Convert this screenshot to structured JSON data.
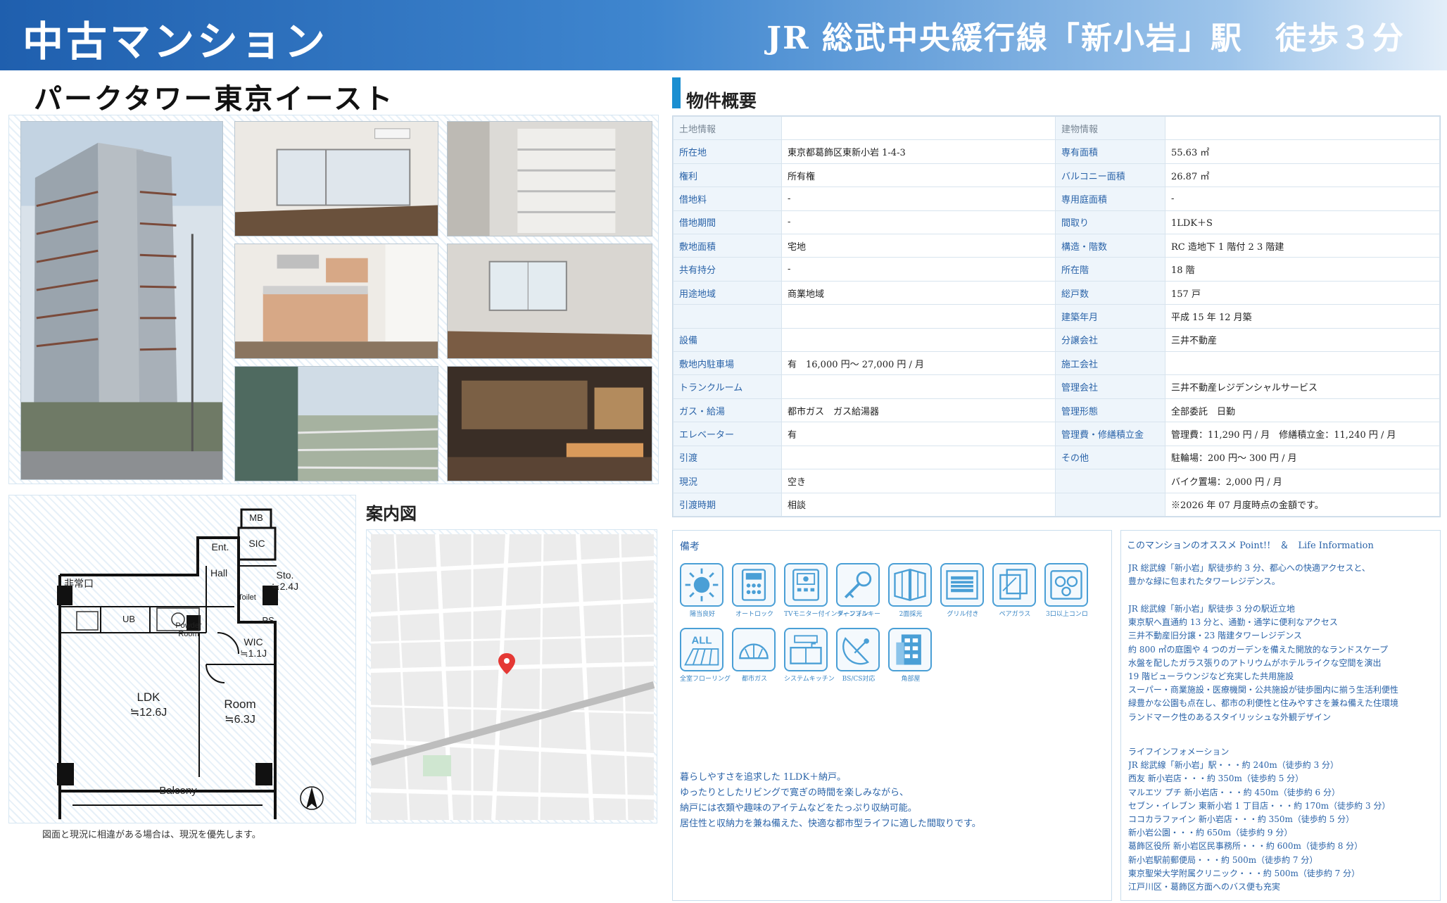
{
  "header": {
    "type_label": "中古マンション",
    "access": "JR 総武中央緩行線「新小岩」駅　徒歩３分"
  },
  "property_name": "パークタワー東京イースト",
  "floorplan": {
    "labels": {
      "mb": "MB",
      "sic": "SIC",
      "ent": "Ent.",
      "hall": "Hall",
      "sto": "Sto.",
      "sto_size": "≒2.4J",
      "emergency": "非常口",
      "toilet": "Toilet",
      "ps": "PS",
      "ub": "UB",
      "powder": "Powder",
      "powder2": "Room",
      "wic": "WIC",
      "wic_size": "≒1.1J",
      "ldk": "LDK",
      "ldk_size": "≒12.6J",
      "room": "Room",
      "room_size": "≒6.3J",
      "balcony": "Balcony"
    },
    "note": "図面と現況に相違がある場合は、現況を優先します。"
  },
  "map": {
    "title": "案内図"
  },
  "overview": {
    "title": "物件概要",
    "rows": [
      {
        "l1": "土地情報",
        "v1": "",
        "l2": "建物情報",
        "v2": ""
      },
      {
        "l1": "所在地",
        "v1": "東京都葛飾区東新小岩 1-4-3",
        "l2": "専有面積",
        "v2": "55.63 ㎡"
      },
      {
        "l1": "権利",
        "v1": "所有権",
        "l2": "バルコニー面積",
        "v2": "26.87 ㎡"
      },
      {
        "l1": "借地料",
        "v1": "-",
        "l2": "専用庭面積",
        "v2": "-"
      },
      {
        "l1": "借地期間",
        "v1": "-",
        "l2": "間取り",
        "v2": "1LDK＋S"
      },
      {
        "l1": "敷地面積",
        "v1": "宅地",
        "l2": "構造・階数",
        "v2": "RC 造地下 1 階付 2 3 階建"
      },
      {
        "l1": "共有持分",
        "v1": "-",
        "l2": "所在階",
        "v2": "18 階"
      },
      {
        "l1": "用途地域",
        "v1": "商業地域",
        "l2": "総戸数",
        "v2": "157 戸"
      },
      {
        "l1": "",
        "v1": "",
        "l2": "建築年月",
        "v2": "平成 15 年 12 月築"
      },
      {
        "l1": "設備",
        "v1": "",
        "l2": "分譲会社",
        "v2": "三井不動産"
      },
      {
        "l1": "敷地内駐車場",
        "v1": " 有　16,000 円〜 27,000 円 / 月",
        "l2": "施工会社",
        "v2": ""
      },
      {
        "l1": "トランクルーム",
        "v1": "",
        "l2": "管理会社",
        "v2": "三井不動産レジデンシャルサービス"
      },
      {
        "l1": "ガス・給湯",
        "v1": "都市ガス　ガス給湯器",
        "l2": "管理形態",
        "v2": "全部委託　日勤"
      },
      {
        "l1": "エレベーター",
        "v1": "有",
        "l2": "管理費・修繕積立金",
        "v2": "管理費：11,290 円 / 月　修繕積立金：11,240 円 / 月"
      },
      {
        "l1": "引渡",
        "v1": "",
        "l2": "その他",
        "v2": "駐輪場：200 円〜 300 円 / 月"
      },
      {
        "l1": "現況",
        "v1": " 空き",
        "l2": "",
        "v2": "バイク置場：2,000 円 / 月"
      },
      {
        "l1": "引渡時期",
        "v1": "相談",
        "l2": "",
        "v2": "※2026 年 07 月度時点の金額です。"
      }
    ]
  },
  "remarks": {
    "title": "備考",
    "icons": [
      {
        "name": "sun-icon",
        "label": "陽当良好"
      },
      {
        "name": "autolock-icon",
        "label": "オートロック"
      },
      {
        "name": "intercom-icon",
        "label": "TVモニター付インターフォン"
      },
      {
        "name": "key-icon",
        "label": "ディンプルキー"
      },
      {
        "name": "window-icon",
        "label": "2面採光"
      },
      {
        "name": "grill-icon",
        "label": "グリル付き"
      },
      {
        "name": "pair-glass-icon",
        "label": "ペアガラス"
      },
      {
        "name": "stove-icon",
        "label": "3口以上コンロ"
      },
      {
        "name": "flooring-icon",
        "label": "全室フローリング"
      },
      {
        "name": "gas-icon",
        "label": "都市ガス"
      },
      {
        "name": "kitchen-icon",
        "label": "システムキッチン"
      },
      {
        "name": "satellite-icon",
        "label": "BS/CS対応"
      },
      {
        "name": "corner-icon",
        "label": "角部屋"
      }
    ],
    "text": [
      "暮らしやすさを追求した 1LDK＋納戸。",
      "ゆったりとしたリビングで寛ぎの時間を楽しみながら、",
      "納戸には衣類や趣味のアイテムなどをたっぷり収納可能。",
      "居住性と収納力を兼ね備えた、快適な都市型ライフに適した間取りです。"
    ]
  },
  "recommend": {
    "title": "このマンションのオススメ Point!!　＆　Life Information",
    "intro": [
      "JR 総武線「新小岩」駅徒歩約 3 分、都心への快適アクセスと、",
      "豊かな緑に包まれたタワーレジデンス。"
    ],
    "points": [
      "JR 総武線「新小岩」駅徒歩 3 分の駅近立地",
      "東京駅へ直通約 13 分と、通勤・通学に便利なアクセス",
      "三井不動産旧分譲・23 階建タワーレジデンス",
      "約 800 ㎡の庭園や 4 つのガーデンを備えた開放的なランドスケープ",
      "水盤を配したガラス張りのアトリウムがホテルライクな空間を演出",
      "19 階ビューラウンジなど充実した共用施設",
      "スーパー・商業施設・医療機関・公共施設が徒歩圏内に揃う生活利便性",
      "緑豊かな公園も点在し、都市の利便性と住みやすさを兼ね備えた住環境",
      "ランドマーク性のあるスタイリッシュな外観デザイン"
    ],
    "life_title": "ライフインフォメーション",
    "life": [
      "JR 総武線「新小岩」駅・・・約 240m（徒歩約 3 分）",
      "西友 新小岩店・・・約 350m（徒歩約 5 分）",
      "マルエツ プチ 新小岩店・・・約 450m（徒歩約 6 分）",
      "セブン・イレブン 東新小岩 1 丁目店・・・約 170m（徒歩約 3 分）",
      "ココカラファイン 新小岩店・・・約 350m（徒歩約 5 分）",
      "新小岩公園・・・約 650m（徒歩約 9 分）",
      "葛飾区役所 新小岩区民事務所・・・約 600m（徒歩約 8 分）",
      "新小岩駅前郵便局・・・約 500m（徒歩約 7 分）",
      "東京聖栄大学附属クリニック・・・約 500m（徒歩約 7 分）",
      "江戸川区・葛飾区方面へのバス便も充実"
    ]
  },
  "colors": {
    "header_start": "#1f5fae",
    "accent": "#1b8fd1",
    "label_text": "#2a63a8",
    "label_bg": "#eef5fb"
  }
}
